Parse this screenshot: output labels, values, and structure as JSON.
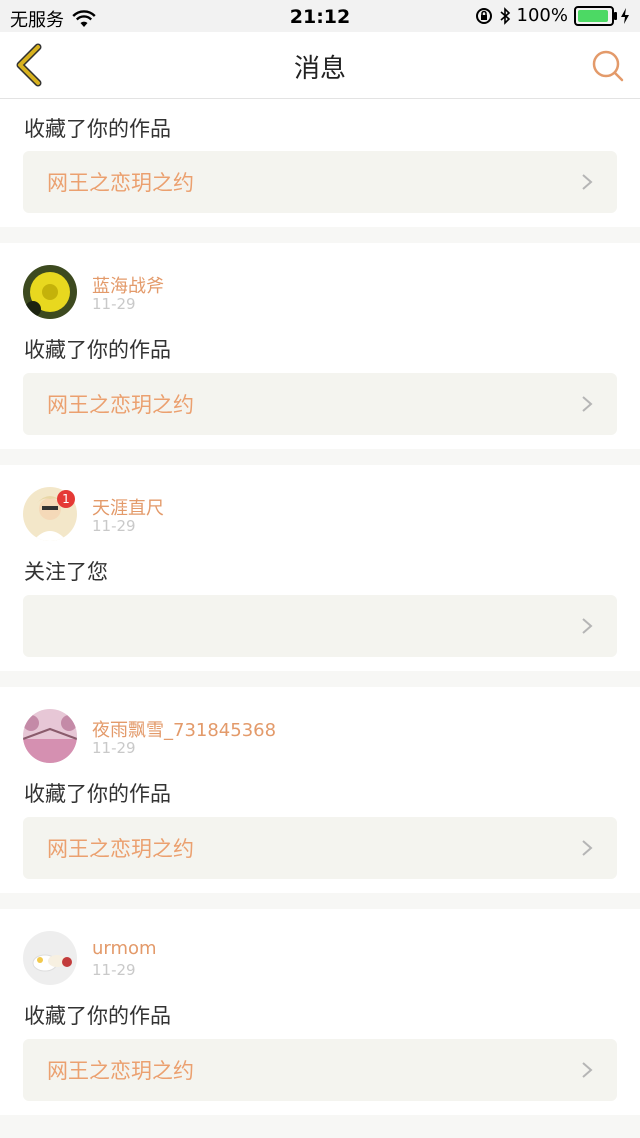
{
  "status_bar": {
    "carrier": "无服务",
    "time": "21:12",
    "battery": "100%"
  },
  "nav": {
    "title": "消息",
    "back_icon": "chevron-left-icon",
    "search_icon": "search-icon"
  },
  "notifications": [
    {
      "action": "收藏了你的作品",
      "work_title": "网王之恋玥之约"
    },
    {
      "username": "蓝海战斧",
      "date": "11-29",
      "action": "收藏了你的作品",
      "work_title": "网王之恋玥之约",
      "avatar": "yellow-flower-avatar"
    },
    {
      "username": "天涯直尺",
      "date": "11-29",
      "action": "关注了您",
      "work_title": "",
      "avatar": "person-avatar",
      "badge": "1"
    },
    {
      "username": "夜雨飘雪_731845368",
      "date": "11-29",
      "action": "收藏了你的作品",
      "work_title": "网王之恋玥之约",
      "avatar": "pink-trees-avatar"
    },
    {
      "username": "urmom",
      "date": "11-29",
      "action": "收藏了你的作品",
      "work_title": "网王之恋玥之约",
      "avatar": "white-flowers-avatar"
    }
  ],
  "colors": {
    "accent": "#e39a6a",
    "back_icon": "#d8b21f",
    "work_box_bg": "#f4f4ef"
  }
}
